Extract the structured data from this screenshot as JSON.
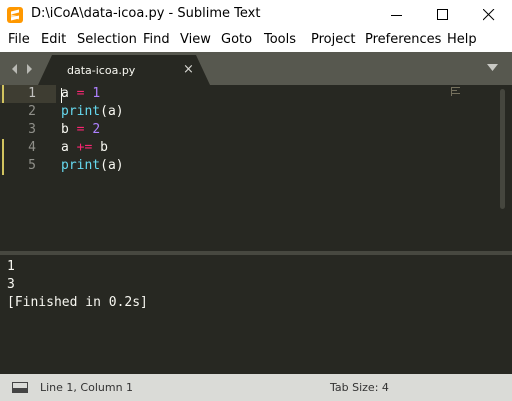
{
  "window": {
    "title": "D:\\iCoA\\data-icoa.py - Sublime Text",
    "app_icon": "sublime-text-icon",
    "controls": [
      "minimize-icon",
      "maximize-icon",
      "close-icon"
    ]
  },
  "menu": {
    "items": [
      {
        "label": "File"
      },
      {
        "label": "Edit"
      },
      {
        "label": "Selection"
      },
      {
        "label": "Find"
      },
      {
        "label": "View"
      },
      {
        "label": "Goto"
      },
      {
        "label": "Tools"
      },
      {
        "label": "Project"
      },
      {
        "label": "Preferences"
      },
      {
        "label": "Help"
      }
    ]
  },
  "tabs": {
    "nav_icons": [
      "chevron-left-icon",
      "chevron-right-icon"
    ],
    "items": [
      {
        "label": "data-icoa.py",
        "close": "×",
        "active": true
      }
    ],
    "dropdown_icon": "triangle-down-icon"
  },
  "editor": {
    "line_numbers": [
      "1",
      "2",
      "3",
      "4",
      "5"
    ],
    "current_line": 1,
    "lines": [
      [
        {
          "text": "a",
          "type": "plain"
        },
        {
          "text": " ",
          "type": "plain"
        },
        {
          "text": "=",
          "type": "keyword"
        },
        {
          "text": " ",
          "type": "plain"
        },
        {
          "text": "1",
          "type": "number"
        }
      ],
      [
        {
          "text": "print",
          "type": "function"
        },
        {
          "text": "(a)",
          "type": "plain"
        }
      ],
      [
        {
          "text": "b",
          "type": "plain"
        },
        {
          "text": " ",
          "type": "plain"
        },
        {
          "text": "=",
          "type": "keyword"
        },
        {
          "text": " ",
          "type": "plain"
        },
        {
          "text": "2",
          "type": "number"
        }
      ],
      [
        {
          "text": "a",
          "type": "plain"
        },
        {
          "text": " ",
          "type": "plain"
        },
        {
          "text": "+=",
          "type": "keyword"
        },
        {
          "text": " ",
          "type": "plain"
        },
        {
          "text": "b",
          "type": "plain"
        }
      ],
      [
        {
          "text": "print",
          "type": "function"
        },
        {
          "text": "(a)",
          "type": "plain"
        }
      ]
    ]
  },
  "output": {
    "lines": [
      "1",
      "3",
      "[Finished in 0.2s]"
    ]
  },
  "status": {
    "panel_icon": "panel-toggle-icon",
    "cursor_position": "Line 1, Column 1",
    "tab_size": "Tab Size: 4"
  },
  "colors": {
    "editor_bg": "#272822",
    "keyword": "#f92672",
    "number": "#ae81ff",
    "function": "#66d9ef",
    "text": "#f8f8f2",
    "gutter_text": "#90908a",
    "modified_marker": "#d1c35f"
  }
}
